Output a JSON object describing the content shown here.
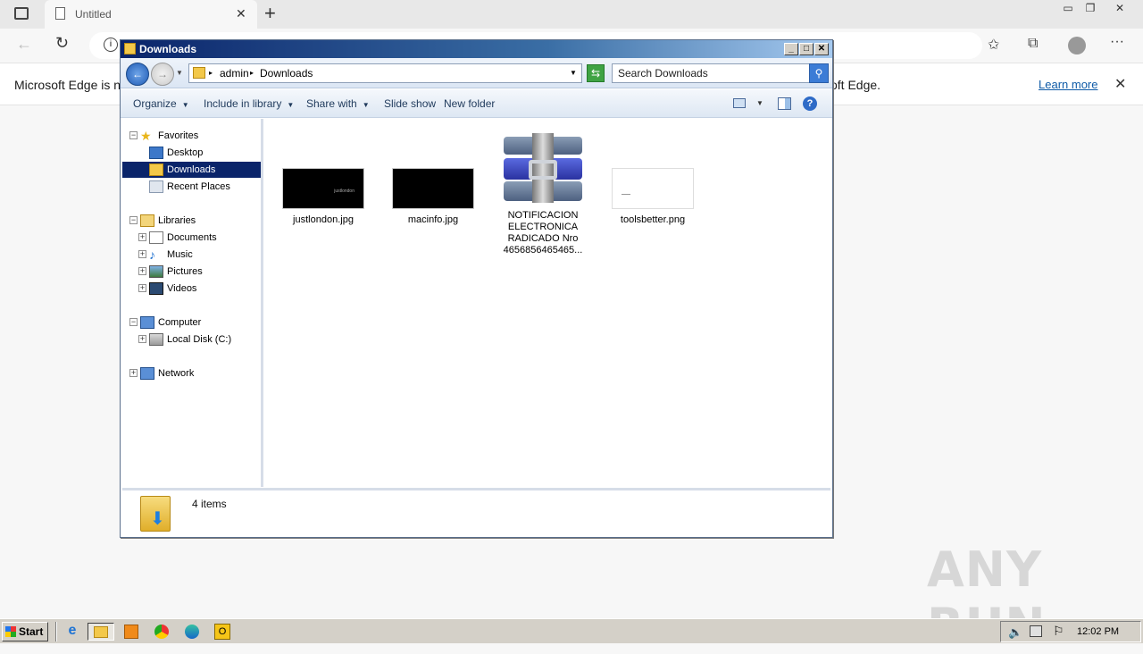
{
  "browser": {
    "tab_title": "Untitled",
    "infobar_message_start": "Microsoft Edge is no",
    "infobar_message_end": "oft Edge.",
    "learn_more": "Learn more"
  },
  "explorer": {
    "title": "Downloads",
    "address": {
      "root": "admin",
      "current": "Downloads"
    },
    "search_placeholder": "Search Downloads",
    "commands": {
      "organize": "Organize",
      "include": "Include in library",
      "share": "Share with",
      "slideshow": "Slide show",
      "newfolder": "New folder"
    },
    "tree": {
      "favorites": "Favorites",
      "desktop": "Desktop",
      "downloads": "Downloads",
      "recent": "Recent Places",
      "libraries": "Libraries",
      "documents": "Documents",
      "music": "Music",
      "pictures": "Pictures",
      "videos": "Videos",
      "computer": "Computer",
      "localdisk": "Local Disk (C:)",
      "network": "Network"
    },
    "files": [
      {
        "name": "justlondon.jpg"
      },
      {
        "name": "macinfo.jpg"
      },
      {
        "name_l1": "NOTIFICACION",
        "name_l2": "ELECTRONICA",
        "name_l3": "RADICADO Nro",
        "name_l4": "4656856465465..."
      },
      {
        "name": "toolsbetter.png"
      }
    ],
    "thumb_caption": "justlondon",
    "item_count": "4 items"
  },
  "taskbar": {
    "start": "Start",
    "clock": "12:02 PM"
  },
  "watermark": "ANY RUN"
}
